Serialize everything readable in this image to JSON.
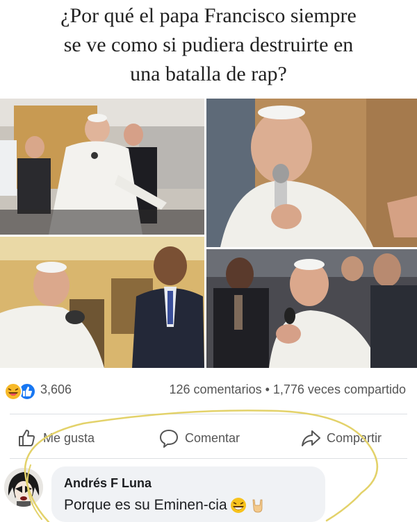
{
  "headline": {
    "line1": "¿Por qué el papa Francisco siempre",
    "line2": "se ve como si pudiera destruirte en",
    "line3": "una batalla de rap?"
  },
  "stats": {
    "reactions_count": "3,606",
    "comments_shares": "126 comentarios • 1,776 veces compartido"
  },
  "actions": {
    "like": "Me gusta",
    "comment": "Comentar",
    "share": "Compartir"
  },
  "comment": {
    "author": "Andrés F Luna",
    "text": "Porque es su Eminen-cia"
  },
  "colors": {
    "like_blue": "#1877f2",
    "haha_yellow": "#f7b928",
    "scribble": "#e3d26a",
    "bubble_bg": "#f0f2f5"
  },
  "icons": [
    "haha-reaction-icon",
    "like-reaction-icon",
    "thumbs-up-icon",
    "comment-icon",
    "share-icon",
    "laughing-emoji-icon",
    "rock-hand-emoji-icon"
  ]
}
